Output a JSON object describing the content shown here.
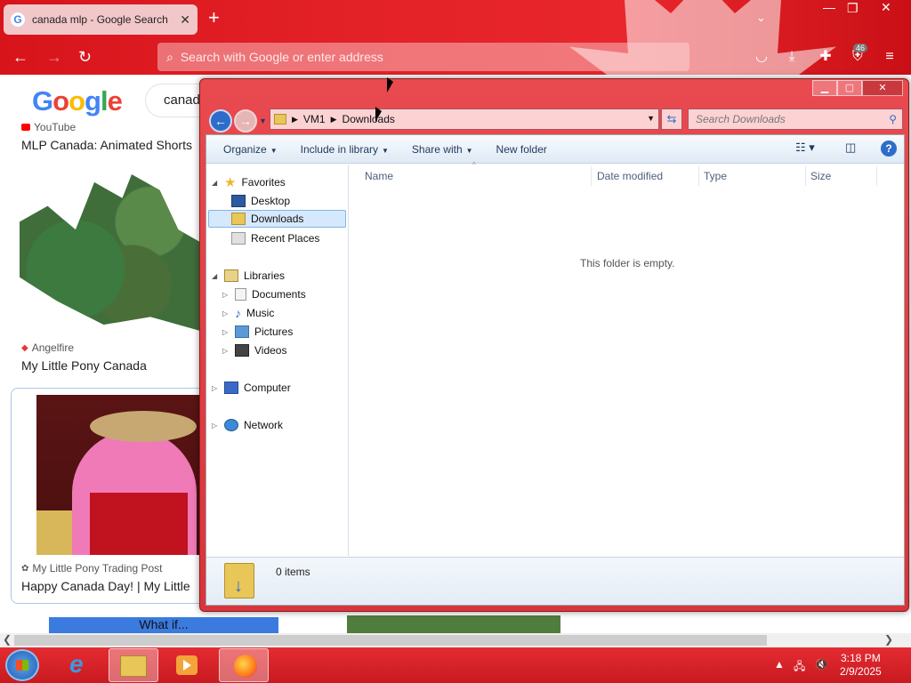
{
  "browser": {
    "tab_title": "canada mlp - Google Search",
    "tab_favicon": "G",
    "new_tab": "+",
    "url_placeholder": "Search with Google or enter address",
    "extensions_badge": "46",
    "colors": {
      "chrome_red": "#e32228",
      "tab_bg": "#f2c7c9"
    }
  },
  "google_page": {
    "logo": "Google",
    "search_value": "canad",
    "results": [
      {
        "source": "YouTube",
        "title": "MLP Canada: Animated Shorts"
      },
      {
        "source": "Angelfire",
        "title": "My Little Pony Canada"
      },
      {
        "source": "My Little Pony Trading Post",
        "title": "Happy Canada Day! | My Little"
      }
    ],
    "banner_text": "What if..."
  },
  "explorer": {
    "breadcrumb": [
      "VM1",
      "Downloads"
    ],
    "search_placeholder": "Search Downloads",
    "toolbar": {
      "organize": "Organize",
      "include_in_library": "Include in library",
      "share_with": "Share with",
      "new_folder": "New folder"
    },
    "nav": {
      "favorites": "Favorites",
      "desktop": "Desktop",
      "downloads": "Downloads",
      "recent_places": "Recent Places",
      "libraries": "Libraries",
      "documents": "Documents",
      "music": "Music",
      "pictures": "Pictures",
      "videos": "Videos",
      "computer": "Computer",
      "network": "Network"
    },
    "columns": [
      "Name",
      "Date modified",
      "Type",
      "Size"
    ],
    "empty_message": "This folder is empty.",
    "item_count": "0 items"
  },
  "taskbar": {
    "time": "3:18 PM",
    "date": "2/9/2025"
  }
}
